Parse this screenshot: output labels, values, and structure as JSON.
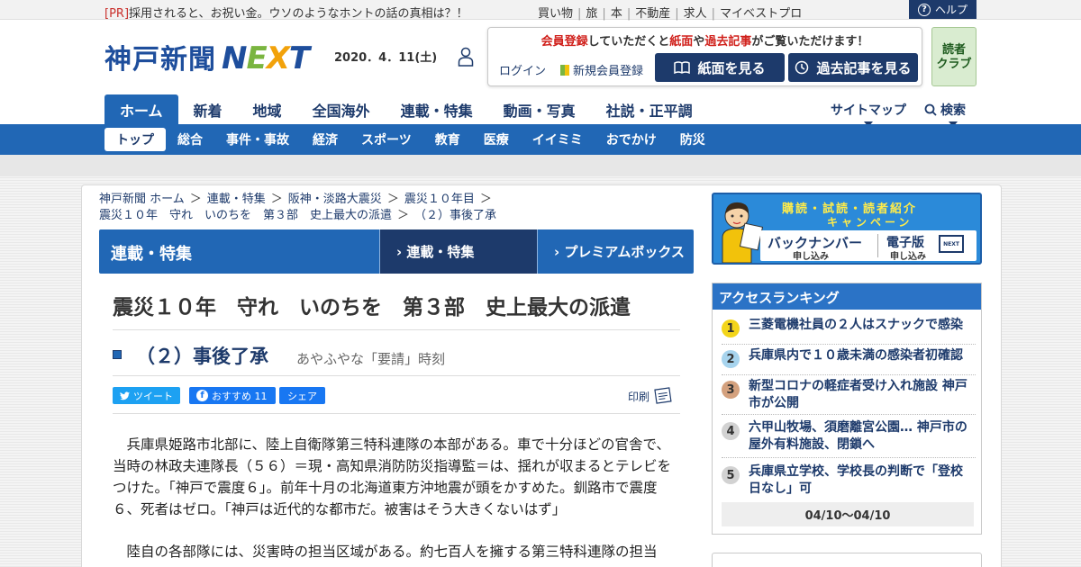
{
  "topbar": {
    "pr_tag": "[PR]",
    "pr_text": "採用されると、お祝い金。ウソのようなホントの話の真相は？！",
    "links": [
      "買い物",
      "旅",
      "本",
      "不動産",
      "求人",
      "マイベストプロ"
    ],
    "help": "ヘルプ"
  },
  "header": {
    "logo_jp": "神戸新聞",
    "logo_next": [
      "N",
      "E",
      "X",
      "T"
    ],
    "date": "2020．4．11(土)",
    "member_msg_1": "会員登録",
    "member_msg_2": "していただくと",
    "member_msg_3": "紙面",
    "member_msg_4": "や",
    "member_msg_5": "過去記事",
    "member_msg_6": "がご覧いただけます！",
    "login": "ログイン",
    "new_register": "新規会員登録",
    "btn_shimen": "紙面を見る",
    "btn_kako": "過去記事を見る",
    "dokusha_1": "読者",
    "dokusha_2": "クラブ"
  },
  "mainnav": [
    "ホーム",
    "新着",
    "地域",
    "全国海外",
    "連載・特集",
    "動画・写真",
    "社説・正平調"
  ],
  "sitemap": "サイトマップ",
  "search": "検索",
  "subnav": [
    "トップ",
    "総合",
    "事件・事故",
    "経済",
    "スポーツ",
    "教育",
    "医療",
    "イイミミ",
    "おでかけ",
    "防災"
  ],
  "breadcrumb": [
    "神戸新聞 ホーム",
    "連載・特集",
    "阪神・淡路大震災",
    "震災１０年目",
    "震災１０年　守れ　いのちを　第３部　史上最大の派遣",
    "（２）事後了承"
  ],
  "section": {
    "title": "連載・特集",
    "tab1": "› 連載・特集",
    "tab2": "› プレミアムボックス"
  },
  "article": {
    "title": "震災１０年　守れ　いのちを　第３部　史上最大の派遣",
    "subtitle": "（２）事後了承",
    "subtitle_note": "あやふやな「要請」時刻",
    "tweet": "ツイート",
    "fb_label": "おすすめ 11",
    "share": "シェア",
    "print": "印刷",
    "para1": "　兵庫県姫路市北部に、陸上自衛隊第三特科連隊の本部がある。車で十分ほどの官舎で、当時の林政夫連隊長（５６）＝現・高知県消防防災指導監＝は、揺れが収まるとテレビをつけた。「神戸で震度６」。前年十月の北海道東方沖地震が頭をかすめた。釧路市で震度６、死者はゼロ。「神戸は近代的な都市だ。被害はそう大きくないはず」",
    "para2": "　陸自の各部隊には、災害時の担当区域がある。約七百人を擁する第三特科連隊の担当"
  },
  "campaign": {
    "head": "購読・試読・読者紹介",
    "head2": "キャンペーン",
    "b1": "バックナンバー",
    "s1": "申し込み",
    "b2": "電子版",
    "s2": "申し込み",
    "tv": "NEXT"
  },
  "ranking": {
    "header": "アクセスランキング",
    "items": [
      {
        "n": "1",
        "text": "三菱電機社員の２人はスナックで感染"
      },
      {
        "n": "2",
        "text": "兵庫県内で１０歳未満の感染者初確認"
      },
      {
        "n": "3",
        "text": "新型コロナの軽症者受け入れ施設 神戸市が公開"
      },
      {
        "n": "4",
        "text": "六甲山牧場、須磨離宮公園… 神戸市の屋外有料施設、閉鎖へ"
      },
      {
        "n": "5",
        "text": "兵庫県立学校、学校長の判断で「登校日なし」可"
      }
    ],
    "period": "04/10～04/10"
  },
  "colors": {
    "navy": "#1d3a6b",
    "blue": "#2167b5",
    "red": "#d0201b"
  }
}
